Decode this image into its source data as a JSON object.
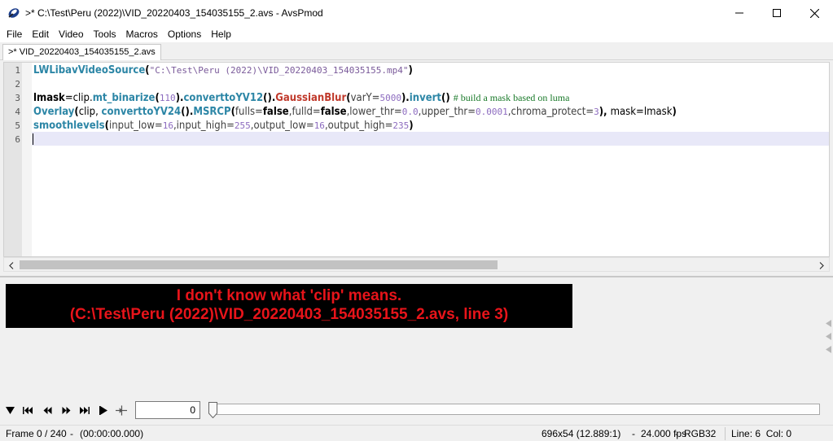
{
  "window": {
    "title": ">* C:\\Test\\Peru (2022)\\VID_20220403_154035155_2.avs - AvsPmod"
  },
  "menu": [
    "File",
    "Edit",
    "Video",
    "Tools",
    "Macros",
    "Options",
    "Help"
  ],
  "tab": {
    "label": ">* VID_20220403_154035155_2.avs"
  },
  "editor": {
    "line_numbers": [
      "1",
      "2",
      "3",
      "4",
      "5",
      "6"
    ],
    "current_line": 6,
    "colors": {
      "function_teal": "#2c86a6",
      "function_red": "#c0392b",
      "number": "#8c6bbf",
      "comment": "#1a7a2a",
      "string": "#7a5a9a"
    },
    "lines": [
      [
        {
          "t": "LWLibavVideoSource",
          "c": "fn-teal"
        },
        {
          "t": "(",
          "c": "kw"
        },
        {
          "t": "\"C:\\Test\\Peru (2022)\\VID_20220403_154035155.mp4\"",
          "c": "str"
        },
        {
          "t": ")",
          "c": "kw"
        }
      ],
      [],
      [
        {
          "t": "lmask",
          "c": "kw"
        },
        {
          "t": "=clip.",
          "c": "plain"
        },
        {
          "t": "mt_binarize",
          "c": "fn-teal"
        },
        {
          "t": "(",
          "c": "kw"
        },
        {
          "t": "110",
          "c": "num"
        },
        {
          "t": ").",
          "c": "kw"
        },
        {
          "t": "converttoYV12",
          "c": "fn-teal"
        },
        {
          "t": "().",
          "c": "kw"
        },
        {
          "t": "GaussianBlur",
          "c": "fn-red"
        },
        {
          "t": "(",
          "c": "kw"
        },
        {
          "t": "varY=",
          "c": "param"
        },
        {
          "t": "5000",
          "c": "num"
        },
        {
          "t": ").",
          "c": "kw"
        },
        {
          "t": "invert",
          "c": "fn-teal"
        },
        {
          "t": "() ",
          "c": "kw"
        },
        {
          "t": "# build a mask based on luma",
          "c": "cmt"
        }
      ],
      [
        {
          "t": "Overlay",
          "c": "fn-teal"
        },
        {
          "t": "(",
          "c": "kw"
        },
        {
          "t": "clip, ",
          "c": "plain"
        },
        {
          "t": "converttoYV24",
          "c": "fn-teal"
        },
        {
          "t": "().",
          "c": "kw"
        },
        {
          "t": "MSRCP",
          "c": "fn-teal"
        },
        {
          "t": "(",
          "c": "kw"
        },
        {
          "t": "fulls=",
          "c": "param"
        },
        {
          "t": "false",
          "c": "kw"
        },
        {
          "t": ",fulld=",
          "c": "param"
        },
        {
          "t": "false",
          "c": "kw"
        },
        {
          "t": ",lower_thr=",
          "c": "param"
        },
        {
          "t": "0.0",
          "c": "num"
        },
        {
          "t": ",upper_thr=",
          "c": "param"
        },
        {
          "t": "0.0001",
          "c": "num"
        },
        {
          "t": ",chroma_protect=",
          "c": "param"
        },
        {
          "t": "3",
          "c": "num"
        },
        {
          "t": "), ",
          "c": "kw"
        },
        {
          "t": "mask=lmask",
          "c": "plain"
        },
        {
          "t": ")",
          "c": "kw"
        }
      ],
      [
        {
          "t": "smoothlevels",
          "c": "fn-teal"
        },
        {
          "t": "(",
          "c": "kw"
        },
        {
          "t": "input_low=",
          "c": "param"
        },
        {
          "t": "16",
          "c": "num"
        },
        {
          "t": ",input_high=",
          "c": "param"
        },
        {
          "t": "255",
          "c": "num"
        },
        {
          "t": ",output_low=",
          "c": "param"
        },
        {
          "t": "16",
          "c": "num"
        },
        {
          "t": ",output_high=",
          "c": "param"
        },
        {
          "t": "235",
          "c": "num"
        },
        {
          "t": ")",
          "c": "kw"
        }
      ],
      []
    ]
  },
  "preview": {
    "error_line1": "I don't know what 'clip' means.",
    "error_line2": "(C:\\Test\\Peru (2022)\\VID_20220403_154035155_2.avs, line 3)",
    "error_color": "#e8141a"
  },
  "transport": {
    "frame_value": "0",
    "buttons": [
      "toggle-preview",
      "first-frame",
      "prev-frame",
      "next-frame",
      "last-frame",
      "play",
      "bookmark"
    ]
  },
  "status": {
    "frame": "Frame 0 / 240",
    "separator": "-",
    "time": "(00:00:00.000)",
    "resolution": "696x54 (12.889:1)",
    "separator2": "-",
    "fps": "24.000 fps",
    "separator3": "-",
    "colorspace": "RGB32",
    "cursor": "Line: 6  Col: 0"
  }
}
